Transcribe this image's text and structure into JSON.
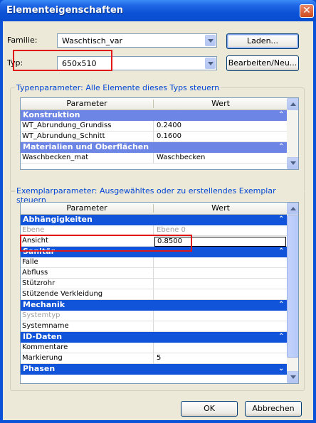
{
  "window": {
    "title": "Elementeigenschaften",
    "close_glyph": "✕"
  },
  "familie": {
    "label": "Familie:",
    "value": "Waschtisch_var"
  },
  "typ": {
    "label": "Typ:",
    "value": "650x510"
  },
  "buttons": {
    "laden": "Laden...",
    "bearbeiten": "Bearbeiten/Neu...",
    "ok": "OK",
    "abbrechen": "Abbrechen"
  },
  "type_params": {
    "title": "Typenparameter: Alle Elemente dieses Typs steuern",
    "col_param": "Parameter",
    "col_value": "Wert",
    "cat_konstruktion": "Konstruktion",
    "row1_name": "WT_Abrundung_Grundiss",
    "row1_value": "0.2400",
    "row2_name": "WT_Abrundung_Schnitt",
    "row2_value": "0.1600",
    "cat_materialien": "Materialien und Oberflächen",
    "row3_name": "Waschbecken_mat",
    "row3_value": "Waschbecken"
  },
  "instance_params": {
    "title": "Exemplarparameter: Ausgewähltes oder zu erstellendes Exemplar steuern",
    "col_param": "Parameter",
    "col_value": "Wert",
    "cat_abh": "Abhängigkeiten",
    "ebene_name": "Ebene",
    "ebene_value": "Ebene 0",
    "ansicht_name": "Ansicht",
    "ansicht_value": "0.8500",
    "cat_sanitaer": "Sanitär",
    "falle": "Falle",
    "abfluss": "Abfluss",
    "stuetzrohr": "Stützrohr",
    "stuetzende": "Stützende Verkleidung",
    "cat_mechanik": "Mechanik",
    "systemtyp": "Systemtyp",
    "systemname": "Systemname",
    "cat_id": "ID-Daten",
    "kommentare": "Kommentare",
    "markierung": "Markierung",
    "markierung_value": "5",
    "cat_phasen": "Phasen"
  },
  "colors": {
    "title_bar": "#0a53d8",
    "category_light": "#6d86e6",
    "category_dark": "#1254d9",
    "highlight_box": "#e01818"
  },
  "icons": {
    "chevron": "collapse-chevron-icon"
  }
}
